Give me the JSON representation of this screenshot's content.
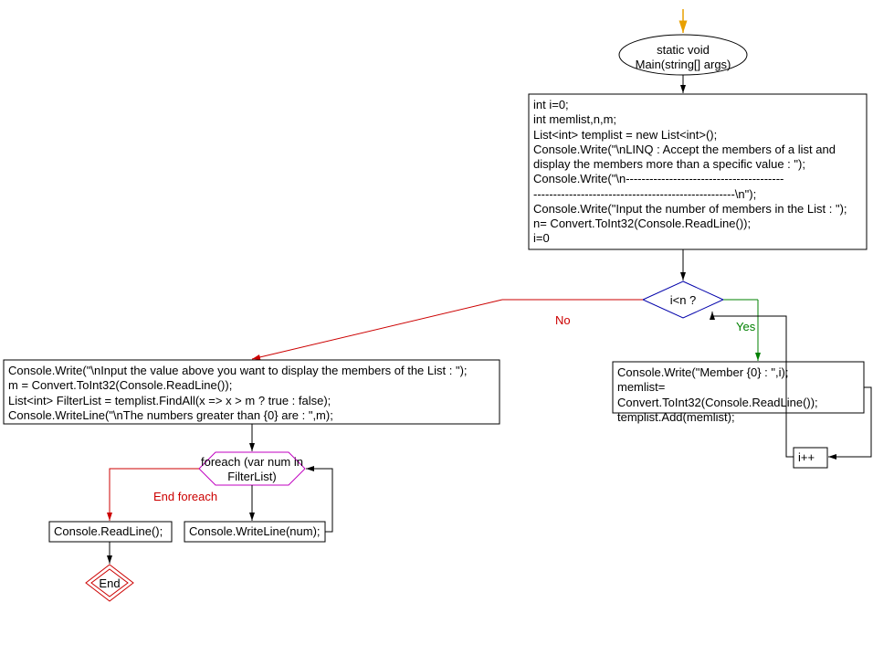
{
  "flowchart": {
    "start_terminator": "static void\nMain(string[] args)",
    "init_block": "int i=0;\nint memlist,n,m;\nList<int> templist = new List<int>();\nConsole.Write(\"\\nLINQ : Accept the members of a list and display the members more than a specific value : \");\nConsole.Write(\"\\n----------------------------------------\n---------------------------------------------------\\n\");\nConsole.Write(\"Input the number of members in the List : \");\nn= Convert.ToInt32(Console.ReadLine());\ni=0",
    "decision": "i<n ?",
    "yes": "Yes",
    "no": "No",
    "loop_body": "Console.Write(\"Member {0} : \",i);\nmemlist= Convert.ToInt32(Console.ReadLine());\ntemplist.Add(memlist);",
    "increment": "i++",
    "after_loop": "Console.Write(\"\\nInput the value above you want to display the members of the List : \");\nm = Convert.ToInt32(Console.ReadLine());\nList<int> FilterList = templist.FindAll(x => x > m ? true : false);\nConsole.WriteLine(\"\\nThe numbers greater than {0} are : \",m);",
    "foreach_header": "foreach (var num\nin FilterList)",
    "end_foreach": "End foreach",
    "foreach_body": "Console.WriteLine(num);",
    "readline": "Console.ReadLine();",
    "end": "End"
  }
}
